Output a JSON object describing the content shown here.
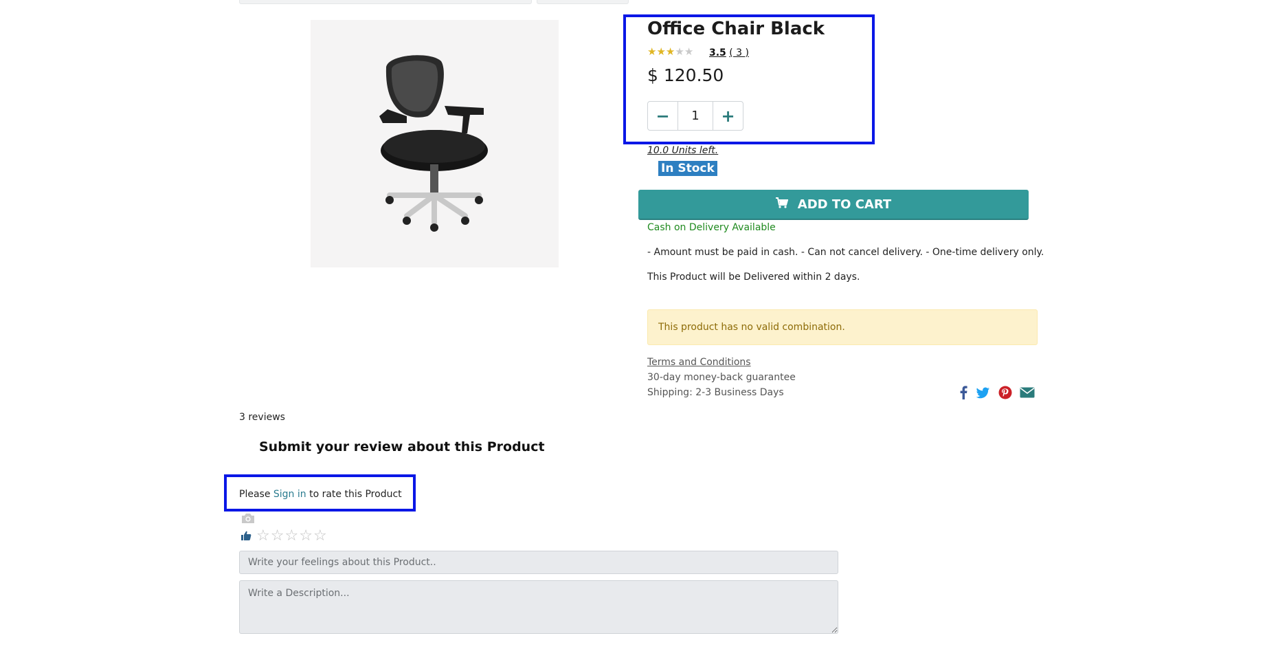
{
  "product": {
    "title": "Office Chair Black",
    "rating_value": "3.5",
    "rating_count": "( 3 )",
    "rating_stars": 3.5,
    "price": "$ 120.50",
    "quantity": "1",
    "units_left": "10.0 Units left.",
    "stock_badge": "In Stock",
    "add_to_cart": "ADD TO CART",
    "cod": "Cash on Delivery Available",
    "cod_terms": "- Amount must be paid in cash. - Can not cancel delivery. - One-time delivery only.",
    "delivery": "This Product will be Delivered within 2 days.",
    "alert": "This product has no valid combination.",
    "terms": "Terms and Conditions",
    "guarantee": "30-day money-back guarantee",
    "shipping": "Shipping: 2-3 Business Days"
  },
  "share": {
    "icons": [
      "facebook-icon",
      "twitter-icon",
      "pinterest-icon",
      "envelope-icon"
    ],
    "colors": {
      "facebook": "#3b5998",
      "twitter": "#1da1f2",
      "pinterest": "#cb2027",
      "email": "#2a7b7b"
    }
  },
  "reviews": {
    "count_label": "3 reviews",
    "submit_title": "Submit your review about this Product",
    "please_prefix": "Please",
    "sign_in": "Sign in",
    "please_suffix": "to rate this Product",
    "feel_placeholder": "Write your feelings about this Product..",
    "desc_placeholder": "Write a Description..."
  },
  "colors": {
    "accent": "#339a9a",
    "highlight": "#0a17e6",
    "stock_badge": "#2d7fc1",
    "cod_text": "#1f8a1f"
  }
}
